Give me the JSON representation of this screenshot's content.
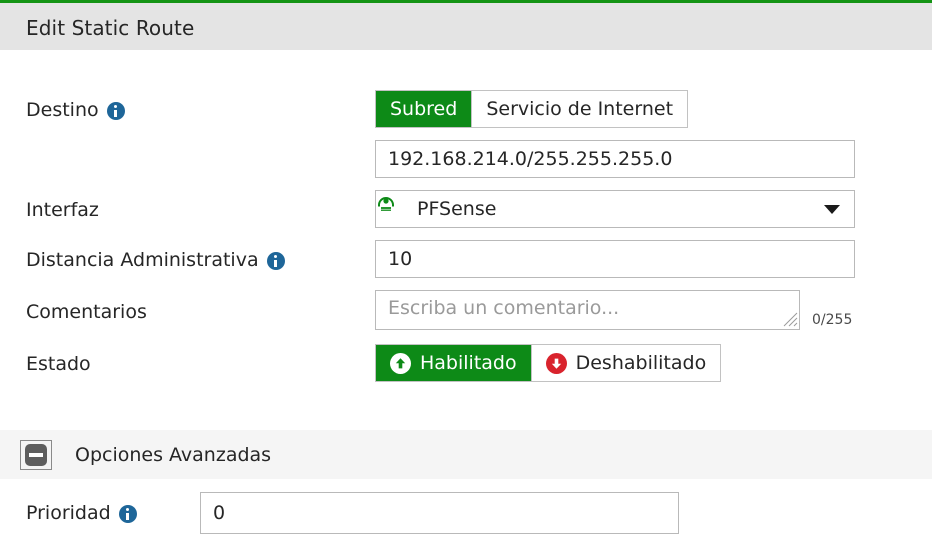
{
  "header": {
    "title": "Edit Static Route",
    "accent_color": "#149414",
    "background": "#e4e4e4"
  },
  "theme": {
    "green": "#0d8a17",
    "red": "#d9232d",
    "info_blue": "#1e6699",
    "border": "#b9b9b9"
  },
  "form": {
    "destino": {
      "label": "Destino",
      "has_info_icon": true,
      "info_icon": "info-circle-icon",
      "options": [
        {
          "label": "Subred",
          "selected": true
        },
        {
          "label": "Servicio de Internet",
          "selected": false
        }
      ],
      "value": "192.168.214.0/255.255.255.0",
      "placeholder": ""
    },
    "interfaz": {
      "label": "Interfaz",
      "has_info_icon": false,
      "selected_option": "PFSense",
      "option_icon": "interface-tunnel-icon",
      "caret_icon": "chevron-down-icon"
    },
    "distancia": {
      "label": "Distancia Administrativa",
      "has_info_icon": true,
      "info_icon": "info-circle-icon",
      "value": "10",
      "placeholder": ""
    },
    "comentarios": {
      "label": "Comentarios",
      "has_info_icon": false,
      "value": "",
      "placeholder": "Escriba un comentario...",
      "counter": "0/255",
      "resize_handle_icon": "resize-grip-icon"
    },
    "estado": {
      "label": "Estado",
      "has_info_icon": false,
      "options": [
        {
          "label": "Habilitado",
          "selected": true,
          "icon": "arrow-up-circle-icon"
        },
        {
          "label": "Deshabilitado",
          "selected": false,
          "icon": "arrow-down-circle-icon"
        }
      ]
    }
  },
  "advanced": {
    "title": "Opciones Avanzadas",
    "toggle_icon": "collapse-minus-icon",
    "expanded": true,
    "prioridad": {
      "label": "Prioridad",
      "has_info_icon": true,
      "info_icon": "info-circle-icon",
      "value": "0",
      "placeholder": ""
    }
  }
}
